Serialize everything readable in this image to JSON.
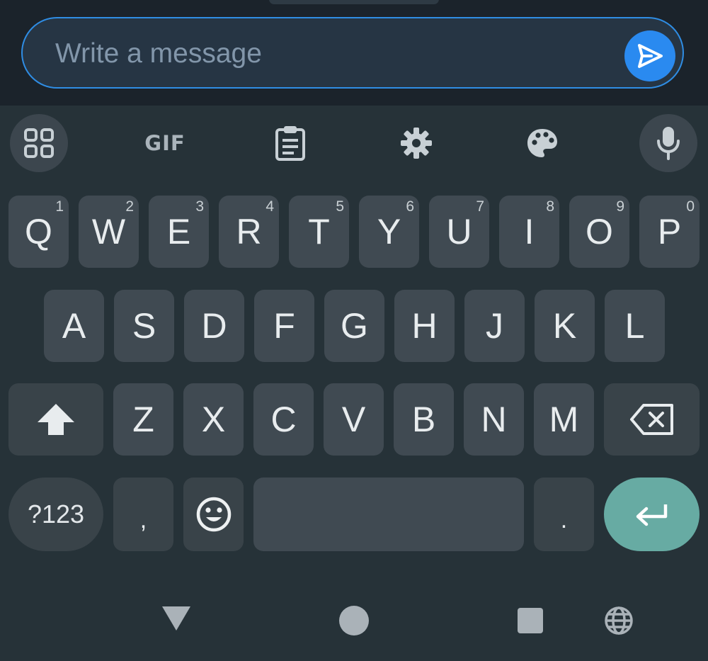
{
  "compose": {
    "placeholder": "Write a message",
    "value": "",
    "colors": {
      "border": "#2f8de4",
      "send_button": "#2a8af0"
    }
  },
  "toolbar": {
    "items": [
      {
        "name": "apps-grid-icon"
      },
      {
        "name": "gif-button",
        "label": "GIF"
      },
      {
        "name": "clipboard-icon"
      },
      {
        "name": "gear-icon"
      },
      {
        "name": "palette-icon"
      },
      {
        "name": "microphone-icon"
      }
    ]
  },
  "keyboard": {
    "row1": [
      {
        "label": "Q",
        "hint": "1"
      },
      {
        "label": "W",
        "hint": "2"
      },
      {
        "label": "E",
        "hint": "3"
      },
      {
        "label": "R",
        "hint": "4"
      },
      {
        "label": "T",
        "hint": "5"
      },
      {
        "label": "Y",
        "hint": "6"
      },
      {
        "label": "U",
        "hint": "7"
      },
      {
        "label": "I",
        "hint": "8"
      },
      {
        "label": "O",
        "hint": "9"
      },
      {
        "label": "P",
        "hint": "0"
      }
    ],
    "row2": [
      {
        "label": "A"
      },
      {
        "label": "S"
      },
      {
        "label": "D"
      },
      {
        "label": "F"
      },
      {
        "label": "G"
      },
      {
        "label": "H"
      },
      {
        "label": "J"
      },
      {
        "label": "K"
      },
      {
        "label": "L"
      }
    ],
    "row3": [
      {
        "label": "Z"
      },
      {
        "label": "X"
      },
      {
        "label": "C"
      },
      {
        "label": "V"
      },
      {
        "label": "B"
      },
      {
        "label": "N"
      },
      {
        "label": "M"
      }
    ],
    "row4": {
      "symbols_label": "?123",
      "comma_label": ",",
      "period_label": "."
    },
    "special_icons": {
      "shift": "shift-arrow-icon",
      "backspace": "backspace-icon",
      "emoji": "smiley-face-icon",
      "enter": "enter-return-icon"
    },
    "colors": {
      "enter_key": "#67aba3",
      "background": "#263238"
    }
  },
  "navbar": {
    "items": [
      "back-triangle-icon",
      "home-circle-icon",
      "recents-square-icon",
      "globe-icon"
    ]
  }
}
